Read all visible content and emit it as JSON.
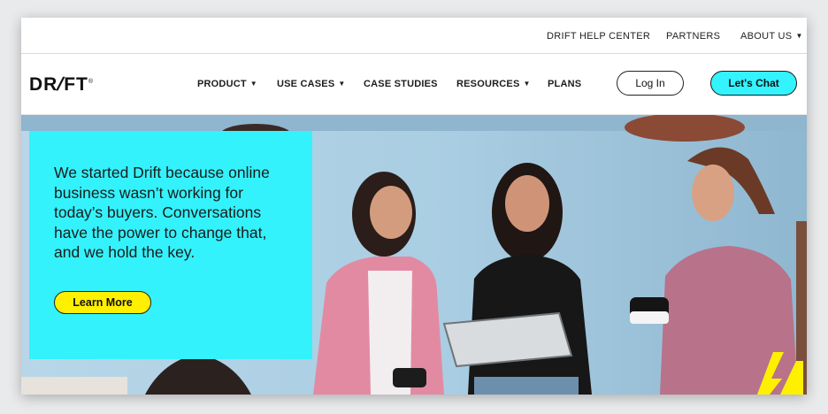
{
  "utility_nav": {
    "help_center": "DRIFT HELP CENTER",
    "partners": "PARTNERS",
    "about_us": "ABOUT US"
  },
  "main_nav": {
    "logo_text_left": "DR",
    "logo_text_right": "FT",
    "logo_mark": "®",
    "items": [
      {
        "label": "PRODUCT",
        "has_dropdown": true
      },
      {
        "label": "USE CASES",
        "has_dropdown": true
      },
      {
        "label": "CASE STUDIES",
        "has_dropdown": false
      },
      {
        "label": "RESOURCES",
        "has_dropdown": true
      },
      {
        "label": "PLANS",
        "has_dropdown": false
      }
    ],
    "login_label": "Log In",
    "chat_label": "Let's Chat"
  },
  "hero": {
    "text": "We started Drift because online business wasn’t working for today’s buyers. Conversations have the power to change that, and we hold the key.",
    "cta_label": "Learn More"
  },
  "colors": {
    "accent_cyan": "#34f2fb",
    "cta_yellow": "#fff000",
    "text_dark": "#1b1b1b"
  },
  "icons": {
    "dropdown": "chevron-down-icon",
    "brand_mark": "lightning-bolt-icon"
  }
}
